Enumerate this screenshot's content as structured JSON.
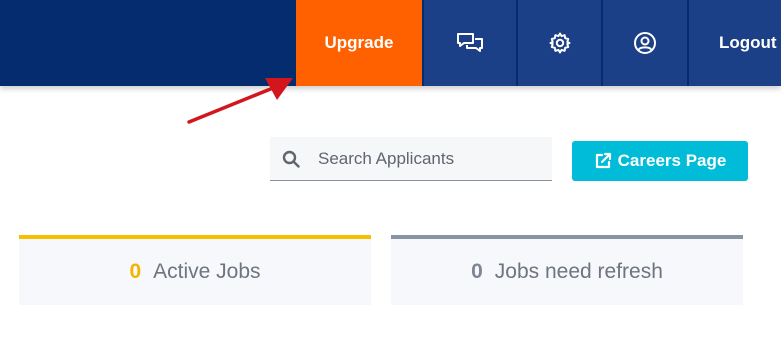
{
  "header": {
    "upgrade_label": "Upgrade",
    "logout_label": "Logout",
    "icons": [
      "chat-icon",
      "gear-icon",
      "user-circle-icon"
    ]
  },
  "search": {
    "placeholder": "Search Applicants",
    "value": ""
  },
  "careers_button": {
    "label": "Careers Page",
    "icon": "external-link-icon"
  },
  "stats": [
    {
      "count": "0",
      "label": "Active Jobs",
      "accent": "#f5c000"
    },
    {
      "count": "0",
      "label": "Jobs need refresh",
      "accent": "#8b93a3"
    }
  ],
  "colors": {
    "topbar": "#052c6e",
    "nav_button": "#1c4087",
    "upgrade": "#ff6100",
    "careers": "#00bcd8",
    "arrow": "#d3161d"
  }
}
